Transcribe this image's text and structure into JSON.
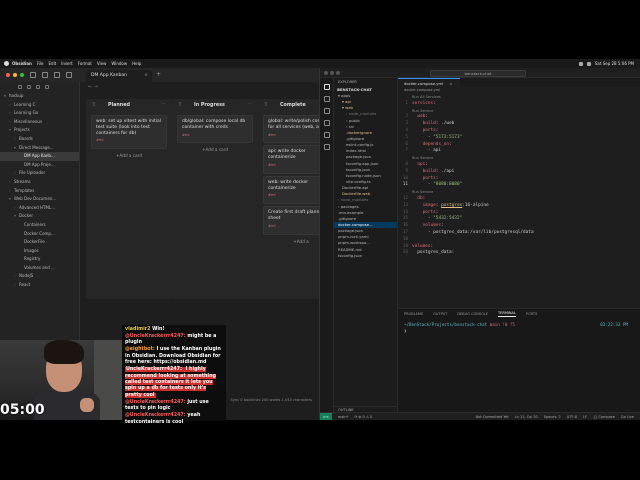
{
  "menubar": {
    "items": [
      "Obsidian",
      "File",
      "Edit",
      "Insert",
      "Format",
      "View",
      "Window",
      "Help"
    ],
    "datetime": "Sat Sep 28 5:06 PM"
  },
  "obsidian": {
    "tab_title": "DM App Kanban",
    "tree": [
      {
        "label": "hackup",
        "depth": 0,
        "arrow": "▾"
      },
      {
        "label": "Learning C",
        "depth": 1,
        "arrow": "›"
      },
      {
        "label": "Learning Go",
        "depth": 1,
        "arrow": "›"
      },
      {
        "label": "Miscellaneous",
        "depth": 1,
        "arrow": "›"
      },
      {
        "label": "Projects",
        "depth": 1,
        "arrow": "▾"
      },
      {
        "label": "Boards",
        "depth": 2,
        "arrow": "›"
      },
      {
        "label": "Direct Message...",
        "depth": 2,
        "arrow": "▾"
      },
      {
        "label": "DM App Kanb...",
        "depth": 3,
        "arrow": "",
        "selected": true
      },
      {
        "label": "DM App Proje...",
        "depth": 3,
        "arrow": ""
      },
      {
        "label": "File Uploader",
        "depth": 2,
        "arrow": "›"
      },
      {
        "label": "Streams",
        "depth": 1,
        "arrow": "›"
      },
      {
        "label": "Templates",
        "depth": 1,
        "arrow": "›"
      },
      {
        "label": "Web Dev Documen...",
        "depth": 1,
        "arrow": "▾"
      },
      {
        "label": "Advanced HTML...",
        "depth": 2,
        "arrow": "›"
      },
      {
        "label": "Docker",
        "depth": 2,
        "arrow": "▾"
      },
      {
        "label": "Containers",
        "depth": 3,
        "arrow": ""
      },
      {
        "label": "Docker Comp...",
        "depth": 3,
        "arrow": ""
      },
      {
        "label": "DockerFile",
        "depth": 3,
        "arrow": ""
      },
      {
        "label": "Images",
        "depth": 3,
        "arrow": ""
      },
      {
        "label": "Registry",
        "depth": 3,
        "arrow": ""
      },
      {
        "label": "Volumes and ...",
        "depth": 3,
        "arrow": ""
      },
      {
        "label": "NodeJS",
        "depth": 2,
        "arrow": "›"
      },
      {
        "label": "React",
        "depth": 2,
        "arrow": "›"
      }
    ],
    "nav_arrows": "←  →",
    "lanes": [
      {
        "title": "Planned",
        "cards": [
          {
            "text": "web: set up vitest with initial test suite (look into test containers for db)",
            "tag": "#mi"
          }
        ],
        "add": "+Add a card"
      },
      {
        "title": "In Progress",
        "cards": [
          {
            "text": "db/global: compose local db container with creds",
            "tag": "#mi"
          }
        ],
        "add": "+Add a card"
      },
      {
        "title": "Complete",
        "cards": [
          {
            "text": "global: write/polish compose for all services (web, api)",
            "tag": "#mi"
          },
          {
            "text": "api: write docker containerize",
            "tag": "#mi"
          },
          {
            "text": "web: write docker containerize",
            "tag": "#mi"
          },
          {
            "text": "Create first draft planning sheet",
            "tag": "#mi"
          }
        ],
        "add": "+Add a"
      }
    ],
    "status": "Sync  0 backlinks  200 words  1,043 characters"
  },
  "vscode": {
    "search": "benstack-chat",
    "explorer_header": "EXPLORER",
    "project": "BENSTACK-CHAT",
    "files": [
      {
        "name": "▾ apps",
        "indent": 0
      },
      {
        "name": "▾ api",
        "indent": 1,
        "mod": true
      },
      {
        "name": "▾ web",
        "indent": 1,
        "mod": true
      },
      {
        "name": "› node_modules",
        "indent": 2,
        "dim": true
      },
      {
        "name": "› public",
        "indent": 2
      },
      {
        "name": "› src",
        "indent": 2
      },
      {
        "name": ".dockerignore",
        "indent": 2,
        "mod": true
      },
      {
        "name": ".gitignore",
        "indent": 2
      },
      {
        "name": "eslint.config.js",
        "indent": 2
      },
      {
        "name": "index.html",
        "indent": 2
      },
      {
        "name": "package.json",
        "indent": 2
      },
      {
        "name": "tsconfig.app.json",
        "indent": 2
      },
      {
        "name": "tsconfig.json",
        "indent": 2
      },
      {
        "name": "tsconfig.node.json",
        "indent": 2
      },
      {
        "name": "vite.config.ts",
        "indent": 2
      },
      {
        "name": "Dockerfile.api",
        "indent": 1
      },
      {
        "name": "Dockerfile.web",
        "indent": 1,
        "mod": true
      },
      {
        "name": "› node_modules",
        "indent": 0,
        "dim": true
      },
      {
        "name": "› packages",
        "indent": 0
      },
      {
        "name": ".env.example",
        "indent": 0
      },
      {
        "name": ".gitignore",
        "indent": 0
      },
      {
        "name": "docker-compose...",
        "indent": 0,
        "selected": true
      },
      {
        "name": "package.json",
        "indent": 0
      },
      {
        "name": "pnpm-lock.yaml",
        "indent": 0
      },
      {
        "name": "pnpm-workspa...",
        "indent": 0
      },
      {
        "name": "README.md",
        "indent": 0
      },
      {
        "name": "tsconfig.json",
        "indent": 0
      }
    ],
    "outline": "OUTLINE",
    "timeline": "TIMELINE",
    "editor_tab": "docker-compose.yml",
    "breadcrumb": "docker-compose.yml",
    "code": [
      {
        "n": "",
        "lens": "Run All Services"
      },
      {
        "n": "1",
        "parts": [
          [
            "k",
            "services"
          ],
          [
            "p",
            ":"
          ]
        ]
      },
      {
        "n": "",
        "lens": "Run Service"
      },
      {
        "n": "2",
        "parts": [
          [
            "p",
            "  "
          ],
          [
            "k",
            "web"
          ],
          [
            "p",
            ":"
          ]
        ]
      },
      {
        "n": "3",
        "parts": [
          [
            "p",
            "    "
          ],
          [
            "k",
            "build"
          ],
          [
            "p",
            ": ./web"
          ]
        ]
      },
      {
        "n": "4",
        "parts": [
          [
            "p",
            "    "
          ],
          [
            "k",
            "ports"
          ],
          [
            "p",
            ":"
          ]
        ]
      },
      {
        "n": "5",
        "parts": [
          [
            "p",
            "      - "
          ],
          [
            "s",
            "\"5173:5173\""
          ]
        ]
      },
      {
        "n": "6",
        "parts": [
          [
            "p",
            "    "
          ],
          [
            "k",
            "depends_on"
          ],
          [
            "p",
            ":"
          ]
        ]
      },
      {
        "n": "7",
        "parts": [
          [
            "p",
            "      - api"
          ]
        ]
      },
      {
        "n": "",
        "lens": "Run Service"
      },
      {
        "n": "8",
        "parts": [
          [
            "p",
            "  "
          ],
          [
            "k",
            "api"
          ],
          [
            "p",
            ":"
          ]
        ]
      },
      {
        "n": "9",
        "parts": [
          [
            "p",
            "    "
          ],
          [
            "k",
            "build"
          ],
          [
            "p",
            ": ./api"
          ]
        ]
      },
      {
        "n": "10",
        "parts": [
          [
            "p",
            "    "
          ],
          [
            "k",
            "ports"
          ],
          [
            "p",
            ":"
          ]
        ]
      },
      {
        "n": "11",
        "parts": [
          [
            "p",
            "      - "
          ],
          [
            "s",
            "\"8080:8080\""
          ]
        ],
        "active": true
      },
      {
        "n": "",
        "lens": "Run Service"
      },
      {
        "n": "12",
        "parts": [
          [
            "p",
            "  "
          ],
          [
            "k",
            "db"
          ],
          [
            "p",
            ":"
          ]
        ]
      },
      {
        "n": "13",
        "parts": [
          [
            "p",
            "    "
          ],
          [
            "k",
            "image"
          ],
          [
            "p",
            ": "
          ],
          [
            "w",
            "postgres"
          ],
          [
            "p",
            ":16-alpine"
          ]
        ]
      },
      {
        "n": "14",
        "parts": [
          [
            "p",
            "    "
          ],
          [
            "k",
            "ports"
          ],
          [
            "p",
            ":"
          ]
        ]
      },
      {
        "n": "15",
        "parts": [
          [
            "p",
            "      - "
          ],
          [
            "s",
            "\"5432:5432\""
          ]
        ]
      },
      {
        "n": "16",
        "parts": [
          [
            "p",
            "    "
          ],
          [
            "k",
            "volumes"
          ],
          [
            "p",
            ":"
          ]
        ]
      },
      {
        "n": "17",
        "parts": [
          [
            "p",
            "      - postgres_data:/var/lib/postgresql/data"
          ]
        ]
      },
      {
        "n": "18",
        "parts": [
          [
            "p",
            ""
          ]
        ]
      },
      {
        "n": "19",
        "parts": [
          [
            "k",
            "volumes"
          ],
          [
            "p",
            ":"
          ]
        ]
      },
      {
        "n": "20",
        "parts": [
          [
            "p",
            "  postgres_data:"
          ]
        ]
      }
    ],
    "panel_tabs": [
      "PROBLEMS",
      "OUTPUT",
      "DEBUG CONSOLE",
      "TERMINAL",
      "PORTS"
    ],
    "panel_active": "TERMINAL",
    "terminal": {
      "path": "~/BenStack/Projects/benstack-chat",
      "git": "main !8 ?5",
      "time": "03:22:33 PM",
      "prompt": "❯"
    },
    "status": {
      "remote": "><",
      "branch": "main*",
      "sync": "⟳  ⊗ 0 ⚠ 0",
      "items": [
        "Not Committed Yet",
        "Ln 11, Col 20",
        "Spaces: 2",
        "UTF-8",
        "LF",
        "{} Compose",
        "Go Live"
      ]
    }
  },
  "chat": {
    "messages": [
      {
        "user": "vladimir2",
        "text": "Win!",
        "style": "g"
      },
      {
        "user": "@UncleKrackerrr4247:",
        "text": "might be a plugin",
        "style": "r"
      },
      {
        "user": "@eightbot:",
        "text": "I use the Kanban plugin in Obsidian. Download Obsidian for free here: https://obsidian.md",
        "style": "pk"
      },
      {
        "user": "UncleKrackerrr4247:",
        "text": "I highly recommend looking at something called test containers it lets you spin up a db for tests only it's pretty cool",
        "style": "hl"
      },
      {
        "user": "@UncleKrackerrr4247:",
        "text": "just use tests to pin logic",
        "style": "r"
      },
      {
        "user": "@UncleKrackerrr4247:",
        "text": "yeah testcontainers is cool",
        "style": "r"
      }
    ]
  },
  "timer": "05:00",
  "colors": {
    "accent_blue": "#3794ff",
    "tag_red": "#e06c75",
    "yaml_key": "#e06c75",
    "yaml_string": "#98c379",
    "chat_highlight": "#cc2d2d"
  }
}
